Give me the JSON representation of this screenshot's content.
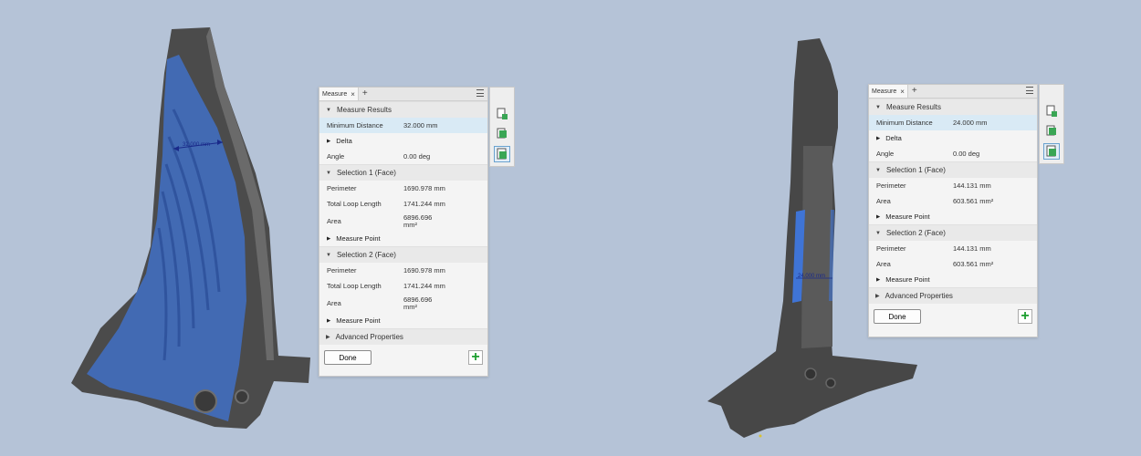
{
  "left": {
    "dimension_label": "32.000 mm",
    "panel": {
      "tab_label": "Measure",
      "tab_close": "×",
      "tab_add": "+",
      "results_header": "Measure Results",
      "min_distance_label": "Minimum Distance",
      "min_distance_value": "32.000 mm",
      "delta_label": "Delta",
      "angle_label": "Angle",
      "angle_value": "0.00 deg",
      "selection1": {
        "header": "Selection 1 (Face)",
        "perimeter_label": "Perimeter",
        "perimeter_value": "1690.978 mm",
        "loop_label": "Total Loop Length",
        "loop_value": "1741.244 mm",
        "area_label": "Area",
        "area_value_line1": "6896.696",
        "area_value_line2": "mm²",
        "measure_point": "Measure Point"
      },
      "selection2": {
        "header": "Selection 2 (Face)",
        "perimeter_label": "Perimeter",
        "perimeter_value": "1690.978 mm",
        "loop_label": "Total Loop Length",
        "loop_value": "1741.244 mm",
        "area_label": "Area",
        "area_value_line1": "6896.696",
        "area_value_line2": "mm²",
        "measure_point": "Measure Point"
      },
      "advanced": "Advanced Properties",
      "done": "Done",
      "add": "+"
    }
  },
  "right": {
    "dimension_label": "24.000 mm",
    "panel": {
      "tab_label": "Measure",
      "tab_close": "×",
      "tab_add": "+",
      "results_header": "Measure Results",
      "min_distance_label": "Minimum Distance",
      "min_distance_value": "24.000 mm",
      "delta_label": "Delta",
      "angle_label": "Angle",
      "angle_value": "0.00 deg",
      "selection1": {
        "header": "Selection 1 (Face)",
        "perimeter_label": "Perimeter",
        "perimeter_value": "144.131 mm",
        "area_label": "Area",
        "area_value": "603.561 mm²",
        "measure_point": "Measure Point"
      },
      "selection2": {
        "header": "Selection 2 (Face)",
        "perimeter_label": "Perimeter",
        "perimeter_value": "144.131 mm",
        "area_label": "Area",
        "area_value": "603.561 mm²",
        "measure_point": "Measure Point"
      },
      "advanced": "Advanced Properties",
      "done": "Done",
      "add": "+"
    }
  },
  "colors": {
    "background": "#b5c3d7",
    "model": "#4a4a4a",
    "selection_face": "#3f74d6",
    "highlight_row": "#d9eaf5",
    "add_green": "#1c9e2f"
  },
  "icons": [
    "measure-selection-icon",
    "measure-face-icon",
    "measure-result-icon",
    "plus-icon",
    "menu-icon"
  ]
}
